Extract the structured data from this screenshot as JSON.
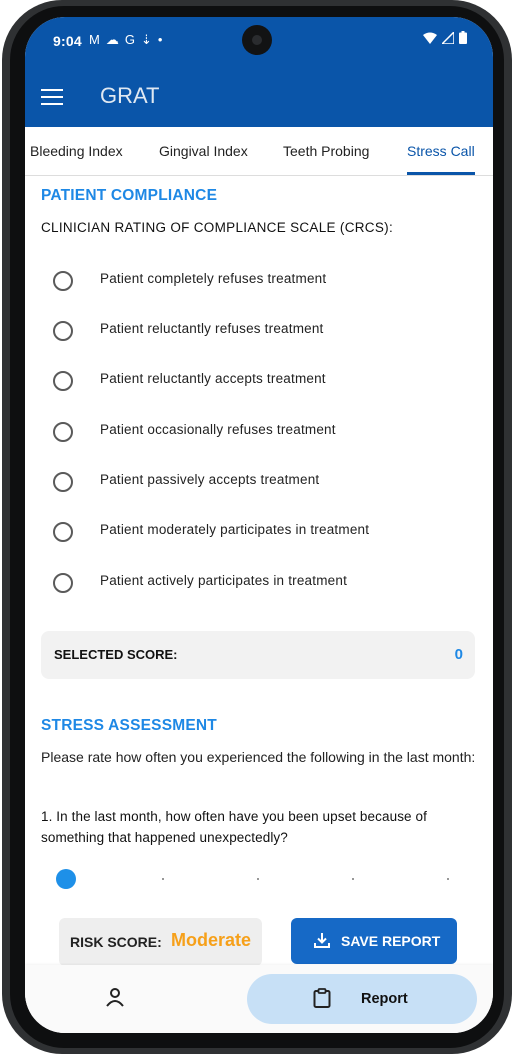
{
  "status_bar": {
    "time": "9:04",
    "left_icons": [
      "M",
      "☁",
      "G",
      "⇣",
      "•"
    ],
    "right_icons": [
      "▼",
      "◢",
      "▮"
    ]
  },
  "app_bar": {
    "title": "GRAT",
    "menu_icon": "hamburger-menu-icon"
  },
  "tabs": [
    {
      "label": "Bleeding Index",
      "active": false
    },
    {
      "label": "Gingival Index",
      "active": false
    },
    {
      "label": "Teeth Probing",
      "active": false
    },
    {
      "label": "Stress Call",
      "active": true
    }
  ],
  "compliance": {
    "title": "PATIENT COMPLIANCE",
    "scale_label": "CLINICIAN RATING OF COMPLIANCE SCALE (CRCS):",
    "options": [
      "Patient completely refuses treatment",
      "Patient reluctantly refuses treatment",
      "Patient reluctantly accepts treatment",
      "Patient occasionally refuses treatment",
      "Patient passively accepts treatment",
      "Patient moderately participates in treatment",
      "Patient actively participates in treatment"
    ],
    "selected_label": "SELECTED SCORE:",
    "selected_value": "0"
  },
  "stress": {
    "title": "STRESS ASSESSMENT",
    "instruction": "Please rate how often you experienced the following in the last month:",
    "question": "1. In the last month, how often have you been upset because of something that happened unexpectedly?",
    "slider_value_index": 0,
    "slider_steps": 5
  },
  "risk": {
    "label": "RISK SCORE:",
    "value": "Moderate",
    "value_color": "#f6a01a"
  },
  "save_button": {
    "label": "SAVE REPORT"
  },
  "bottom_nav": {
    "profile_icon": "person-icon",
    "report_label": "Report",
    "report_icon": "clipboard-icon"
  },
  "colors": {
    "primary": "#0a55a9",
    "accent": "#1e88e5",
    "pill": "#c7e0f6"
  }
}
